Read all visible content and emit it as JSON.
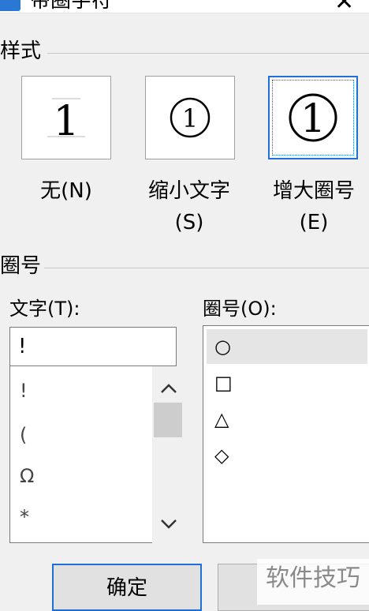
{
  "window": {
    "title": "带圈字符"
  },
  "style_group": {
    "title": "样式",
    "options": [
      {
        "glyph": "1",
        "label_line1": "无(N)",
        "label_line2": ""
      },
      {
        "glyph": "①",
        "label_line1": "缩小文字",
        "label_line2": "(S)"
      },
      {
        "glyph": "①",
        "label_line1": "增大圈号",
        "label_line2": "(E)"
      }
    ],
    "selected": 2
  },
  "enclosure_group": {
    "title": "圈号",
    "text_label": "文字(T):",
    "text_value": "!",
    "char_list": [
      "!",
      "(",
      "Ω",
      "*"
    ],
    "enc_label": "圈号(O):",
    "enc_list": [
      "○",
      "□",
      "△",
      "◇"
    ],
    "enc_selected": 0
  },
  "buttons": {
    "ok": "确定",
    "cancel": ""
  },
  "watermark": "软件技巧",
  "colors": {
    "accent": "#1f6fd6",
    "selection": "#e5e5e5"
  }
}
